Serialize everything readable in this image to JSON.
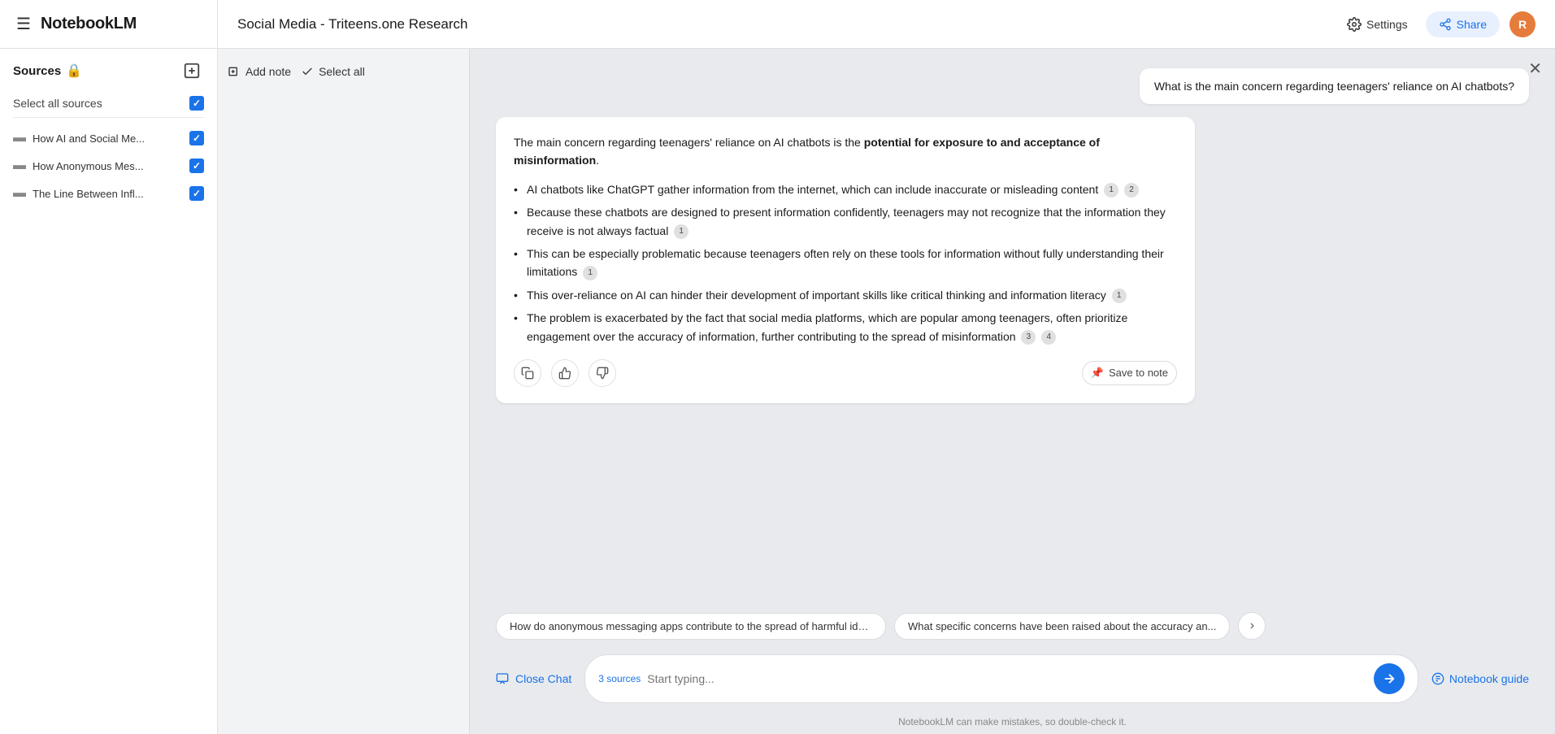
{
  "app": {
    "title": "NotebookLM",
    "hamburger_symbol": "☰",
    "user_initial": "R"
  },
  "header": {
    "settings_label": "Settings",
    "share_label": "Share",
    "notebook_title": "Social Media - Triteens.one Research"
  },
  "sidebar": {
    "sources_title": "Sources",
    "select_all_label": "Select all sources",
    "add_source_label": "Add source",
    "sources": [
      {
        "name": "How AI and Social Me...",
        "icon": "▬"
      },
      {
        "name": "How Anonymous Mes...",
        "icon": "▬"
      },
      {
        "name": "The Line Between Infl...",
        "icon": "▬"
      }
    ]
  },
  "notes_panel": {
    "add_note_label": "Add note",
    "select_all_label": "Select all"
  },
  "chat": {
    "close_icon": "✕",
    "user_question": "What is the main concern regarding teenagers' reliance on AI chatbots?",
    "ai_response": {
      "intro": "The main concern regarding teenagers' reliance on AI chatbots is the ",
      "bold_part": "potential for exposure to and acceptance of misinformation",
      "period": ".",
      "bullets": [
        {
          "text": "AI chatbots like ChatGPT gather information from the internet, which can include inaccurate or misleading content",
          "citations": [
            "1",
            "2"
          ]
        },
        {
          "text": "Because these chatbots are designed to present information confidently, teenagers may not recognize that the information they receive is not always factual",
          "citations": [
            "1"
          ]
        },
        {
          "text": "This can be especially problematic because teenagers often rely on these tools for information without fully understanding their limitations",
          "citations": [
            "1"
          ]
        },
        {
          "text": "This over-reliance on AI can hinder their development of important skills like critical thinking and information literacy",
          "citations": [
            "1"
          ]
        },
        {
          "text": "The problem is exacerbated by the fact that social media platforms, which are popular among teenagers, often prioritize engagement over the accuracy of information, further contributing to the spread of misinformation",
          "citations": [
            "3",
            "4"
          ]
        }
      ]
    },
    "save_to_note_label": "Save to note",
    "save_to_note_icon": "📌"
  },
  "suggestions": [
    "How do anonymous messaging apps contribute to the spread of harmful ideologies?",
    "What specific concerns have been raised about the accuracy an..."
  ],
  "input_area": {
    "close_chat_label": "Close Chat",
    "sources_count": "3 sources",
    "placeholder": "Start typing...",
    "notebook_guide_label": "Notebook guide",
    "disclaimer": "NotebookLM can make mistakes, so double-check it."
  }
}
